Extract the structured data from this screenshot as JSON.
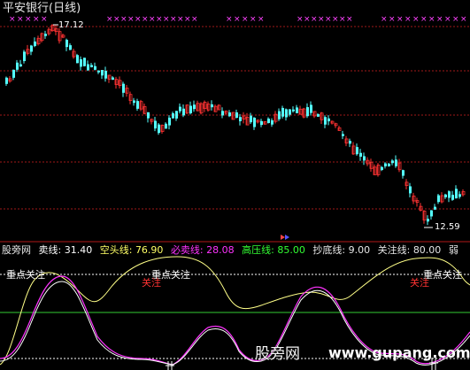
{
  "chart_title": "平安银行(日线)",
  "price_high_label": "17.12",
  "price_low_label": "12.59",
  "indicator": {
    "name": "股旁网",
    "items": [
      {
        "label": "卖线:",
        "value": "31.40",
        "color": "#ffffff"
      },
      {
        "label": "空头线:",
        "value": "76.90",
        "color": "#ffff66"
      },
      {
        "label": "必卖线:",
        "value": "28.08",
        "color": "#ff33ff"
      },
      {
        "label": "高压线:",
        "value": "85.00",
        "color": "#33ff33"
      },
      {
        "label": "抄底线:",
        "value": "9.00",
        "color": "#e6e6e6"
      },
      {
        "label": "关注线:",
        "value": "80.00",
        "color": "#e6e6e6"
      },
      {
        "label": "弱",
        "value": "",
        "color": "#e6e6e6"
      }
    ]
  },
  "annotations": [
    {
      "text": "重点关注",
      "color": "#ffffff"
    },
    {
      "text": "重点关注",
      "color": "#ffffff"
    },
    {
      "text": "关注",
      "color": "#ff3333"
    },
    {
      "text": "重点关注",
      "color": "#ffffff"
    },
    {
      "text": "关注",
      "color": "#ff3333"
    }
  ],
  "watermark": {
    "text": "股旁网",
    "url": "www.gupang.com"
  },
  "colors": {
    "up": "#ff3232",
    "down": "#54ffff",
    "grid": "#a01818",
    "marker": "#ff44ff"
  }
}
